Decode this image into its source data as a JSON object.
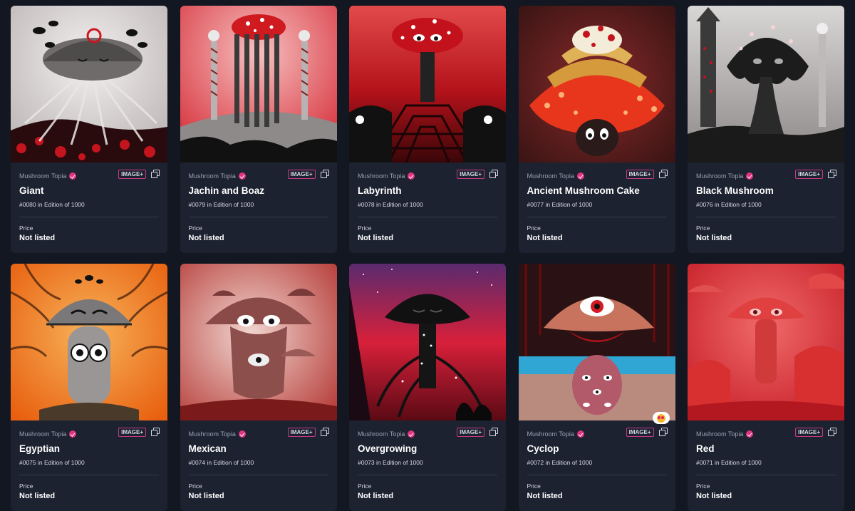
{
  "cards": [
    {
      "creator": "Mushroom Topia",
      "badge": "IMAGE+",
      "title": "Giant",
      "edition": "#0080 in Edition of 1000",
      "price_label": "Price",
      "price": "Not listed",
      "art_icon": "mushroom-artwork"
    },
    {
      "creator": "Mushroom Topia",
      "badge": "IMAGE+",
      "title": "Jachin and Boaz",
      "edition": "#0079 in Edition of 1000",
      "price_label": "Price",
      "price": "Not listed",
      "art_icon": "mushroom-artwork"
    },
    {
      "creator": "Mushroom Topia",
      "badge": "IMAGE+",
      "title": "Labyrinth",
      "edition": "#0078 in Edition of 1000",
      "price_label": "Price",
      "price": "Not listed",
      "art_icon": "mushroom-artwork"
    },
    {
      "creator": "Mushroom Topia",
      "badge": "IMAGE+",
      "title": "Ancient Mushroom Cake",
      "edition": "#0077 in Edition of 1000",
      "price_label": "Price",
      "price": "Not listed",
      "art_icon": "mushroom-artwork"
    },
    {
      "creator": "Mushroom Topia",
      "badge": "IMAGE+",
      "title": "Black Mushroom",
      "edition": "#0076 in Edition of 1000",
      "price_label": "Price",
      "price": "Not listed",
      "art_icon": "mushroom-artwork"
    },
    {
      "creator": "Mushroom Topia",
      "badge": "IMAGE+",
      "title": "Egyptian",
      "edition": "#0075 in Edition of 1000",
      "price_label": "Price",
      "price": "Not listed",
      "art_icon": "mushroom-artwork"
    },
    {
      "creator": "Mushroom Topia",
      "badge": "IMAGE+",
      "title": "Mexican",
      "edition": "#0074 in Edition of 1000",
      "price_label": "Price",
      "price": "Not listed",
      "art_icon": "mushroom-artwork"
    },
    {
      "creator": "Mushroom Topia",
      "badge": "IMAGE+",
      "title": "Overgrowing",
      "edition": "#0073 in Edition of 1000",
      "price_label": "Price",
      "price": "Not listed",
      "art_icon": "mushroom-artwork"
    },
    {
      "creator": "Mushroom Topia",
      "badge": "IMAGE+",
      "title": "Cyclop",
      "edition": "#0072 in Edition of 1000",
      "price_label": "Price",
      "price": "Not listed",
      "art_icon": "mushroom-artwork",
      "reaction_icon": "heart-eyes-emoji-icon"
    },
    {
      "creator": "Mushroom Topia",
      "badge": "IMAGE+",
      "title": "Red",
      "edition": "#0071 in Edition of 1000",
      "price_label": "Price",
      "price": "Not listed",
      "art_icon": "mushroom-artwork"
    }
  ],
  "colors": {
    "page_background": "#131722",
    "card_background": "#1c2230",
    "verified_badge": "#e0357e",
    "type_badge_border": "#c83a84"
  }
}
